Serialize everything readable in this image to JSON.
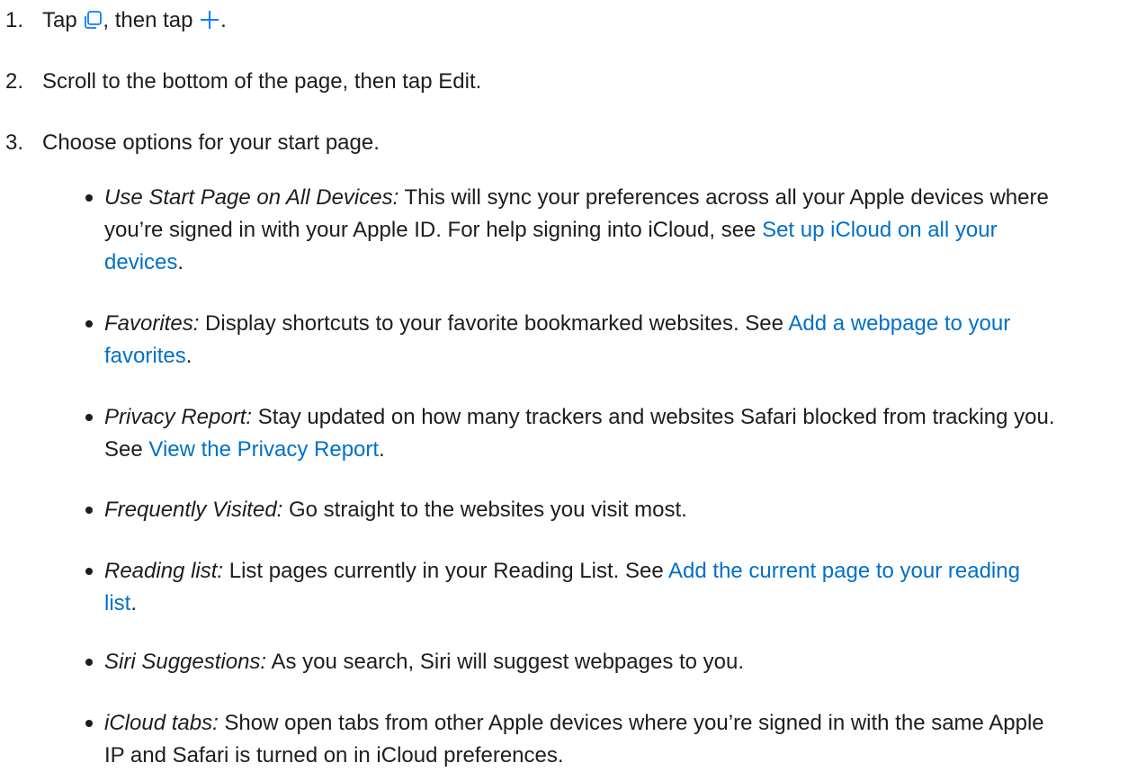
{
  "steps": [
    {
      "num": "1.",
      "before": "Tap ",
      "middle": ", then tap ",
      "after": "."
    },
    {
      "num": "2.",
      "text": "Scroll to the bottom of the page, then tap Edit."
    },
    {
      "num": "3.",
      "text": "Choose options for your start page."
    }
  ],
  "icons": {
    "tabs": "tabs-icon",
    "plus": "plus-icon",
    "color": "#0a7cff"
  },
  "link_color": "#0070c9",
  "bullets": [
    {
      "term": "Use Start Page on All Devices:",
      "text": " This will sync your preferences across all your Apple devices where you’re signed in with your Apple ID. For help signing into iCloud, see ",
      "link": "Set up iCloud on all your devices",
      "after": "."
    },
    {
      "term": "Favorites:",
      "text": " Display shortcuts to your favorite bookmarked websites. See ",
      "link": "Add a webpage to your favorites",
      "after": "."
    },
    {
      "term": "Privacy Report:",
      "text": " Stay updated on how many trackers and websites Safari blocked from tracking you. See ",
      "link": "View the Privacy Report",
      "after": "."
    },
    {
      "term": "Frequently Visited:",
      "text": " Go straight to the websites you visit most."
    },
    {
      "term": "Reading list:",
      "text": " List pages currently in your Reading List. See ",
      "link": "Add the current page to your reading list",
      "after": "."
    },
    {
      "term": "Siri Suggestions:",
      "text": " As you search, Siri will suggest webpages to you."
    },
    {
      "term": "iCloud tabs:",
      "text": " Show open tabs from other Apple devices where you’re signed in with the same Apple IP and Safari is turned on in iCloud preferences."
    }
  ]
}
